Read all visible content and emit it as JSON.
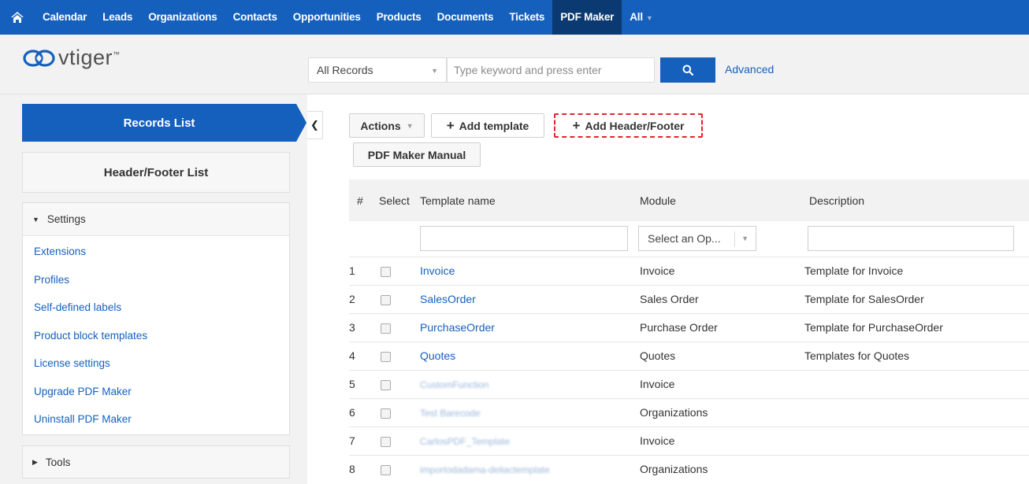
{
  "nav": {
    "items": [
      "Calendar",
      "Leads",
      "Organizations",
      "Contacts",
      "Opportunities",
      "Products",
      "Documents",
      "Tickets",
      "PDF Maker"
    ],
    "active": "PDF Maker",
    "all_label": "All"
  },
  "logo": {
    "text": "vtiger",
    "tm": "™"
  },
  "search": {
    "scope": "All Records",
    "placeholder": "Type keyword and press enter",
    "advanced": "Advanced"
  },
  "sidebar": {
    "records_list": "Records List",
    "header_footer_list": "Header/Footer List",
    "settings": {
      "title": "Settings",
      "links": [
        "Extensions",
        "Profiles",
        "Self-defined labels",
        "Product block templates",
        "License settings",
        "Upgrade PDF Maker",
        "Uninstall PDF Maker"
      ]
    },
    "tools": "Tools"
  },
  "toolbar": {
    "actions": "Actions",
    "add_template": "Add template",
    "add_header_footer": "Add Header/Footer",
    "manual": "PDF Maker Manual"
  },
  "table": {
    "headers": [
      "#",
      "Select",
      "Template name",
      "Module",
      "Description"
    ],
    "module_filter_placeholder": "Select an Op...",
    "rows": [
      {
        "num": "1",
        "name": "Invoice",
        "module": "Invoice",
        "description": "Template for Invoice",
        "blurred": false
      },
      {
        "num": "2",
        "name": "SalesOrder",
        "module": "Sales Order",
        "description": "Template for SalesOrder",
        "blurred": false
      },
      {
        "num": "3",
        "name": "PurchaseOrder",
        "module": "Purchase Order",
        "description": "Template for PurchaseOrder",
        "blurred": false
      },
      {
        "num": "4",
        "name": "Quotes",
        "module": "Quotes",
        "description": "Templates for Quotes",
        "blurred": false
      },
      {
        "num": "5",
        "name": "CustomFunction",
        "module": "Invoice",
        "description": "",
        "blurred": true
      },
      {
        "num": "6",
        "name": "Test Barecode",
        "module": "Organizations",
        "description": "",
        "blurred": true
      },
      {
        "num": "7",
        "name": "CarlosPDF_Template",
        "module": "Invoice",
        "description": "",
        "blurred": true
      },
      {
        "num": "8",
        "name": "importodadama-deliactemplate",
        "module": "Organizations",
        "description": "",
        "blurred": true
      }
    ]
  },
  "colors": {
    "brand_blue": "#1560bd",
    "nav_active": "#0b3a72",
    "highlight_dash": "#e0262d"
  }
}
